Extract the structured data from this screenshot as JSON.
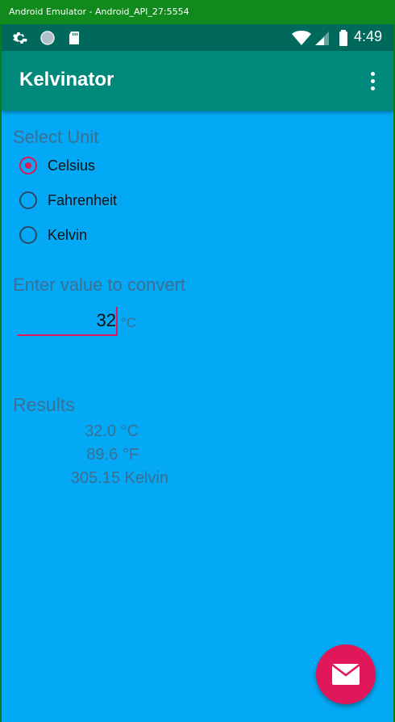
{
  "window": {
    "title": "Android Emulator - Android_API_27:5554"
  },
  "statusbar": {
    "time": "4:49",
    "icons": [
      "gear-icon",
      "circle-icon",
      "sd-card-icon",
      "wifi-icon",
      "signal-icon",
      "battery-icon"
    ]
  },
  "appbar": {
    "title": "Kelvinator",
    "menu_icon": "overflow-menu-icon"
  },
  "unit_section": {
    "label": "Select Unit",
    "options": [
      {
        "label": "Celsius",
        "checked": true
      },
      {
        "label": "Fahrenheit",
        "checked": false
      },
      {
        "label": "Kelvin",
        "checked": false
      }
    ]
  },
  "input_section": {
    "label": "Enter value to convert",
    "value": "32",
    "unit": "°C"
  },
  "results": {
    "label": "Results",
    "lines": [
      "32.0 °C",
      "89.6 °F",
      "305.15 Kelvin"
    ]
  },
  "fab": {
    "icon": "mail-icon"
  },
  "colors": {
    "background": "#03a9f4",
    "appbar": "#00897b",
    "statusbar": "#00695c",
    "accent": "#e0185a",
    "label_text": "#3d6f93"
  }
}
